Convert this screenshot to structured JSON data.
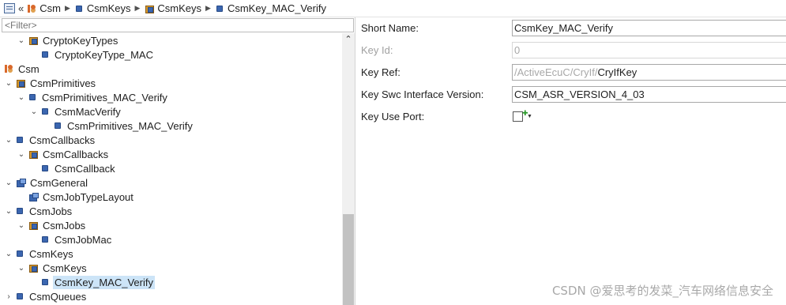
{
  "breadcrumb": {
    "items": [
      "Csm",
      "CsmKeys",
      "CsmKeys",
      "CsmKey_MAC_Verify"
    ]
  },
  "filter": {
    "placeholder": "<Filter>"
  },
  "tree": [
    {
      "label": "CryptoKeyTypes",
      "twisty": "expanded",
      "icon": "folder-icon"
    },
    {
      "label": "CryptoKeyType_MAC",
      "twisty": "none",
      "icon": "node-icon"
    },
    {
      "label": "Csm",
      "twisty": "expanded",
      "icon": "csm-module-icon"
    },
    {
      "label": "CsmPrimitives",
      "twisty": "expanded",
      "icon": "folder-icon"
    },
    {
      "label": "CsmPrimitives_MAC_Verify",
      "twisty": "expanded",
      "icon": "node-icon"
    },
    {
      "label": "CsmMacVerify",
      "twisty": "expanded",
      "icon": "node-icon"
    },
    {
      "label": "CsmPrimitives_MAC_Verify",
      "twisty": "none",
      "icon": "node-icon"
    },
    {
      "label": "CsmCallbacks",
      "twisty": "expanded",
      "icon": "node-icon"
    },
    {
      "label": "CsmCallbacks",
      "twisty": "expanded",
      "icon": "folder-icon"
    },
    {
      "label": "CsmCallback",
      "twisty": "none",
      "icon": "node-icon"
    },
    {
      "label": "CsmGeneral",
      "twisty": "expanded",
      "icon": "general-icon"
    },
    {
      "label": "CsmJobTypeLayout",
      "twisty": "none",
      "icon": "general-icon"
    },
    {
      "label": "CsmJobs",
      "twisty": "expanded",
      "icon": "node-icon"
    },
    {
      "label": "CsmJobs",
      "twisty": "expanded",
      "icon": "folder-icon"
    },
    {
      "label": "CsmJobMac",
      "twisty": "none",
      "icon": "node-icon"
    },
    {
      "label": "CsmKeys",
      "twisty": "expanded",
      "icon": "node-icon"
    },
    {
      "label": "CsmKeys",
      "twisty": "expanded",
      "icon": "folder-icon"
    },
    {
      "label": "CsmKey_MAC_Verify",
      "twisty": "none",
      "icon": "node-icon",
      "selected": true
    },
    {
      "label": "CsmQueues",
      "twisty": "collapsed",
      "icon": "node-icon"
    }
  ],
  "properties": {
    "short_name": {
      "label": "Short Name:",
      "value": "CsmKey_MAC_Verify"
    },
    "key_id": {
      "label": "Key Id:",
      "value": "0"
    },
    "key_ref": {
      "label": "Key Ref:",
      "prefix": "/ActiveEcuC/CryIf/",
      "value": "CryIfKey"
    },
    "key_swc_interface_version": {
      "label": "Key Swc Interface Version:",
      "value": "CSM_ASR_VERSION_4_03"
    },
    "key_use_port": {
      "label": "Key Use Port:",
      "checked": false
    }
  },
  "watermark": "CSDN @爱思考的发菜_汽车网络信息安全"
}
